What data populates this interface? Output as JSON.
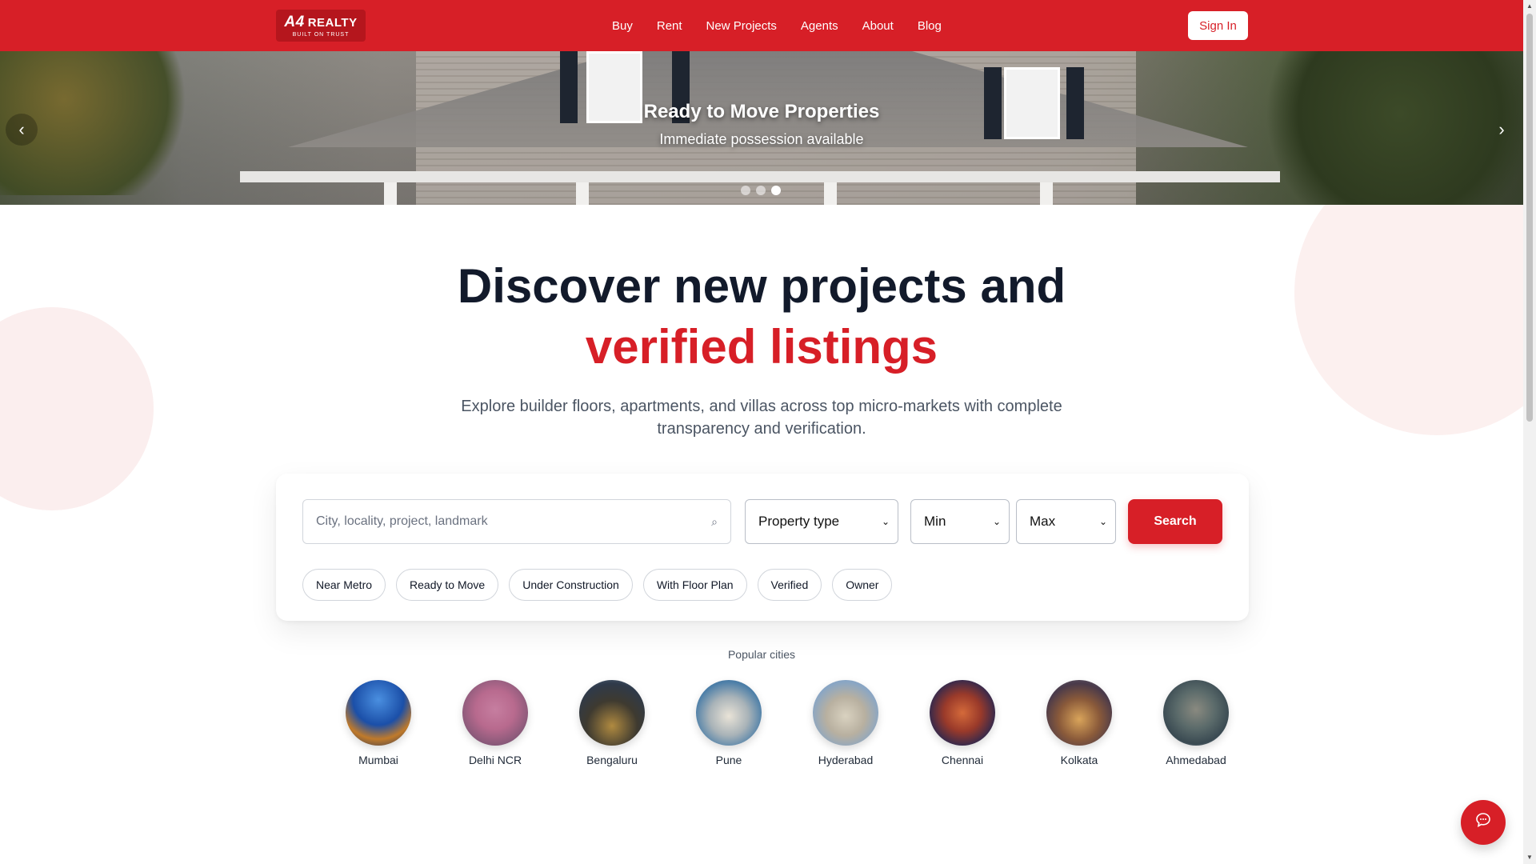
{
  "brand": {
    "logo_main": "REALTY",
    "logo_mark": "A4",
    "logo_tagline": "BUILT ON TRUST"
  },
  "nav": {
    "items": [
      {
        "label": "Buy"
      },
      {
        "label": "Rent"
      },
      {
        "label": "New Projects"
      },
      {
        "label": "Agents"
      },
      {
        "label": "About"
      },
      {
        "label": "Blog"
      }
    ],
    "signin_label": "Sign In"
  },
  "hero": {
    "title": "Ready to Move Properties",
    "subtitle": "Immediate possession available",
    "prev_icon": "chevron-left-icon",
    "next_icon": "chevron-right-icon",
    "slides_total": 3,
    "active_slide": 3
  },
  "headline": {
    "line1": "Discover new projects and",
    "line2": "verified listings"
  },
  "lede": "Explore builder floors, apartments, and villas across top micro-markets with complete transparency and verification.",
  "search": {
    "placeholder": "City, locality, project, landmark",
    "property_type": "Property type",
    "min": "Min",
    "max": "Max",
    "button": "Search",
    "chips": [
      "Near Metro",
      "Ready to Move",
      "Under Construction",
      "With Floor Plan",
      "Verified",
      "Owner"
    ]
  },
  "cities": {
    "title": "Popular cities",
    "items": [
      {
        "name": "Mumbai"
      },
      {
        "name": "Delhi NCR"
      },
      {
        "name": "Bengaluru"
      },
      {
        "name": "Pune"
      },
      {
        "name": "Hyderabad"
      },
      {
        "name": "Chennai"
      },
      {
        "name": "Kolkata"
      },
      {
        "name": "Ahmedabad"
      }
    ]
  },
  "colors": {
    "brand_red": "#d71f27",
    "heading": "#121a2b"
  },
  "chat_icon": "chat-bubble-icon"
}
